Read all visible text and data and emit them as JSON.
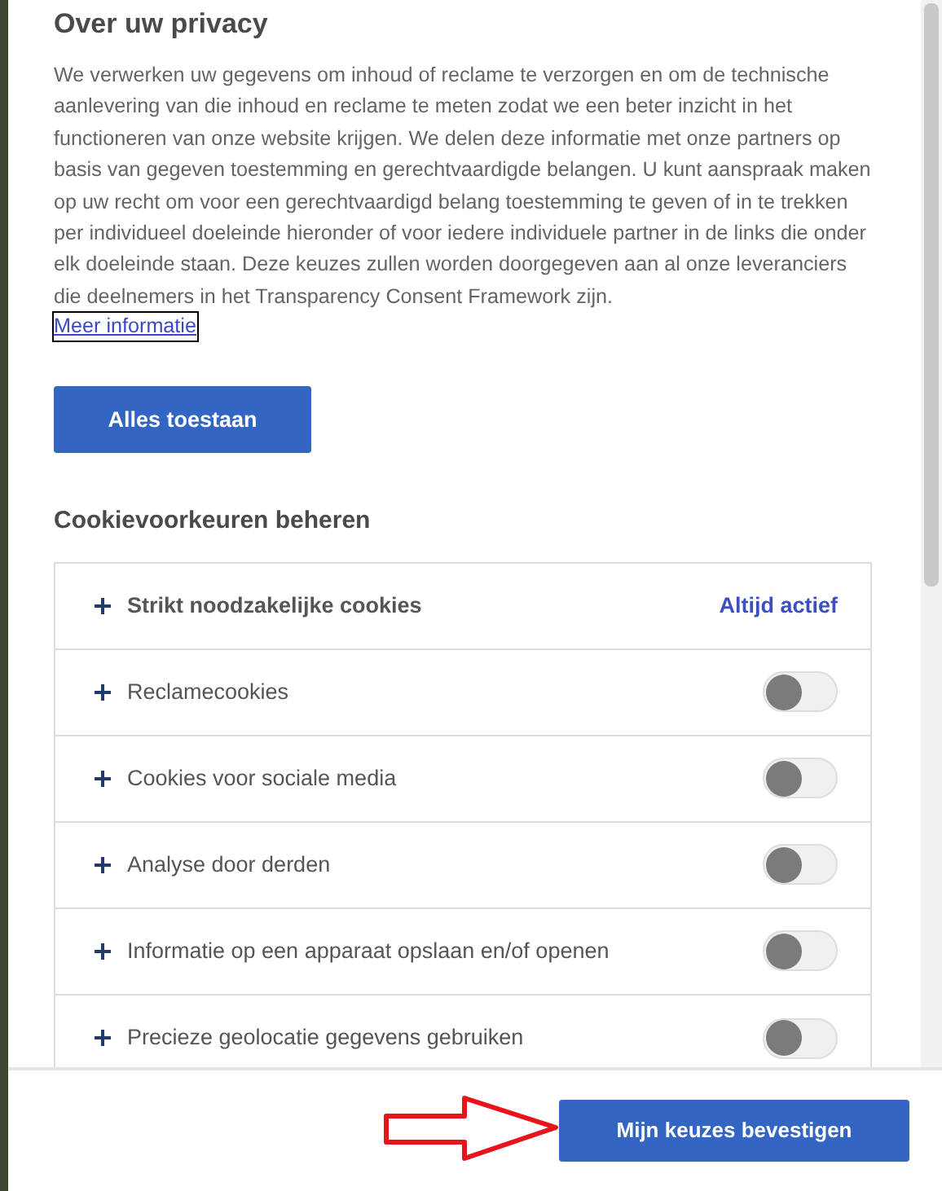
{
  "privacy": {
    "title": "Over uw privacy",
    "text": "We verwerken uw gegevens om inhoud of reclame te verzorgen en om de technische aanlevering van die inhoud en reclame te meten zodat we een beter inzicht in het functioneren van onze website krijgen. We delen deze informatie met onze partners op basis van gegeven toestemming en gerechtvaardigde belangen. U kunt aanspraak maken op uw recht om voor een gerechtvaardigd belang toestemming te geven of in te trekken per individueel doeleinde hieronder of voor iedere individuele partner in de links die onder elk doeleinde staan. Deze keuzes zullen worden doorgegeven aan al onze leveranciers die deelnemers in het Transparency Consent Framework zijn.",
    "link": "Meer informatie",
    "allow_all_button": "Alles toestaan"
  },
  "preferences": {
    "title": "Cookievoorkeuren beheren",
    "items": [
      {
        "kind": "always",
        "label": "Strikt noodzakelijke cookies",
        "status": "Altijd actief",
        "expanded": false
      },
      {
        "kind": "toggle",
        "label": "Reclamecookies",
        "on": false,
        "expanded": false
      },
      {
        "kind": "toggle",
        "label": "Cookies voor sociale media",
        "on": false,
        "expanded": false
      },
      {
        "kind": "toggle",
        "label": "Analyse door derden",
        "on": false,
        "expanded": false
      },
      {
        "kind": "toggle",
        "label": "Informatie op een apparaat opslaan en/of openen",
        "on": false,
        "expanded": false
      },
      {
        "kind": "toggle",
        "label": "Precieze geolocatie gegevens gebruiken",
        "on": false,
        "expanded": false
      }
    ]
  },
  "footer": {
    "confirm_button": "Mijn keuzes bevestigen"
  }
}
